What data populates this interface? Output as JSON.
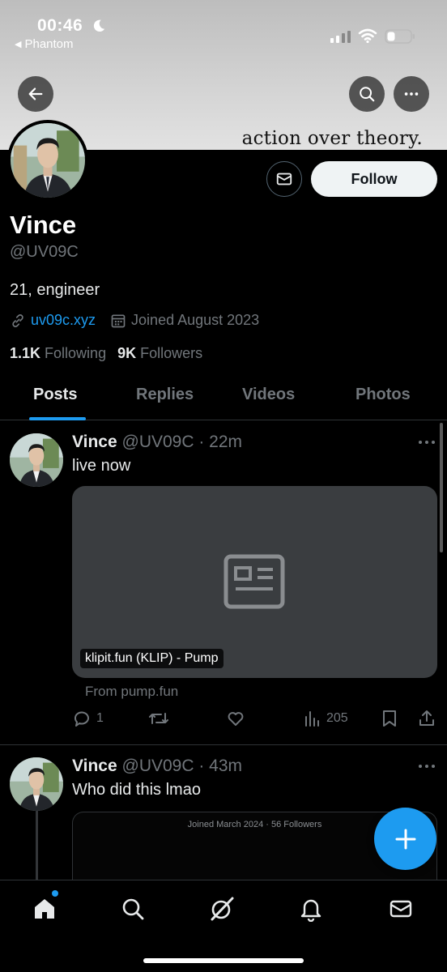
{
  "status_bar": {
    "time": "00:46",
    "back_app": "Phantom"
  },
  "banner": {
    "motto": "action over theory."
  },
  "profile": {
    "name": "Vince",
    "handle": "@UV09C",
    "bio": "21, engineer",
    "website": "uv09c.xyz",
    "joined": "Joined August 2023",
    "following_count": "1.1K",
    "following_label": "Following",
    "followers_count": "9K",
    "followers_label": "Followers",
    "follow_label": "Follow"
  },
  "tabs": [
    {
      "label": "Posts",
      "active": true
    },
    {
      "label": "Replies",
      "active": false
    },
    {
      "label": "Videos",
      "active": false
    },
    {
      "label": "Photos",
      "active": false
    }
  ],
  "posts": [
    {
      "name": "Vince",
      "handle_time": "@UV09C · 22m",
      "text": "live now",
      "card_label": "klipit.fun (KLIP) - Pump",
      "card_source": "From pump.fun",
      "replies": "1",
      "views": "205"
    },
    {
      "name": "Vince",
      "handle_time": "@UV09C · 43m",
      "text": "Who did this lmao",
      "embed_text": "Joined March 2024 · 56 Followers"
    }
  ],
  "icons": {
    "back": "arrow-left-icon",
    "search": "search-icon",
    "more": "more-horizontal-icon",
    "message": "envelope-icon",
    "link": "link-icon",
    "calendar": "calendar-icon",
    "reply": "speech-bubble-icon",
    "repost": "repost-icon",
    "like": "heart-icon",
    "views": "bar-chart-icon",
    "bookmark": "bookmark-icon",
    "share": "share-icon",
    "compose": "plus-icon",
    "home": "home-icon",
    "grok": "grok-icon",
    "notifications": "bell-icon",
    "messages": "envelope-icon"
  },
  "colors": {
    "accent": "#1d9bf0",
    "background": "#000000",
    "muted": "#71767b",
    "text": "#e7e9ea"
  }
}
